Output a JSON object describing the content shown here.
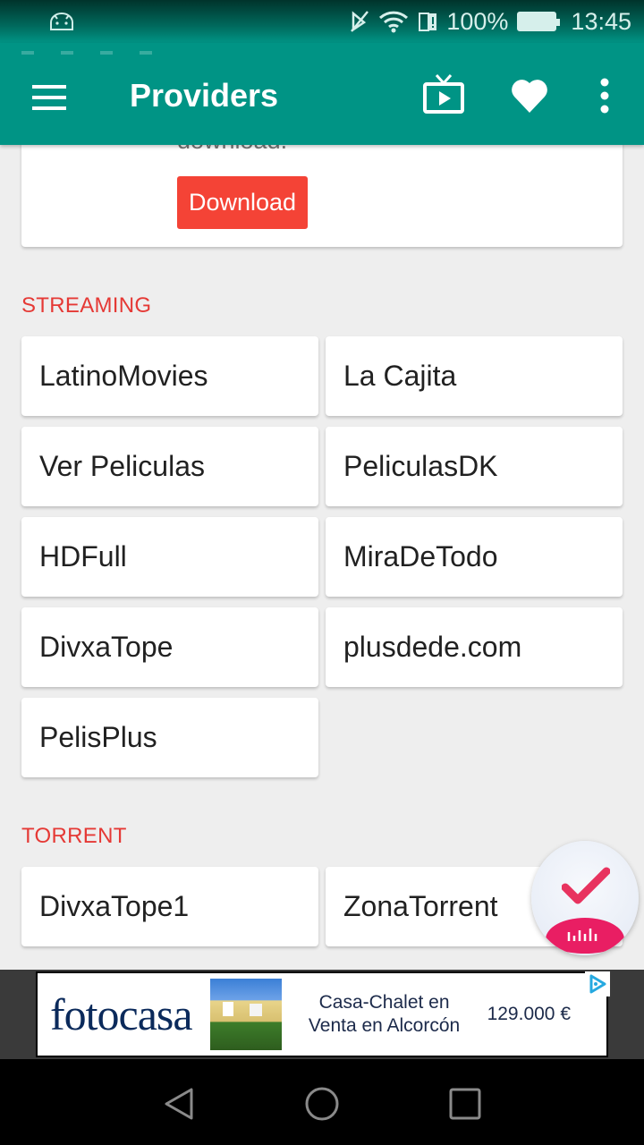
{
  "status_bar": {
    "battery_percent": "100%",
    "time": "13:45",
    "icons": [
      "android-notification-icon",
      "mute-icon",
      "wifi-icon",
      "sim-alert-icon",
      "battery-icon"
    ]
  },
  "app_bar": {
    "title": "Providers",
    "icons": [
      "menu-icon",
      "tv-play-icon",
      "heart-icon",
      "more-vert-icon"
    ]
  },
  "promo": {
    "text_fragment": "download.",
    "button_label": "Download",
    "button_color": "#f44336"
  },
  "sections": [
    {
      "title": "STREAMING",
      "providers": [
        "LatinoMovies",
        "La Cajita",
        "Ver Peliculas",
        "PeliculasDK",
        "HDFull",
        "MiraDeTodo",
        "DivxaTope",
        "plusdede.com",
        "PelisPlus"
      ]
    },
    {
      "title": "TORRENT",
      "providers": [
        "DivxaTope1",
        "ZonaTorrent"
      ]
    }
  ],
  "colors": {
    "primary": "#009485",
    "accent": "#e53935",
    "background": "#eeeeee"
  },
  "ad": {
    "brand": "fotocasa",
    "headline_line1": "Casa-Chalet en",
    "headline_line2": "Venta en Alcorcón",
    "price": "129.000 €"
  },
  "fab": {
    "icon": "check-voice-icon"
  },
  "nav_bar": {
    "buttons": [
      "back",
      "home",
      "recents"
    ]
  }
}
